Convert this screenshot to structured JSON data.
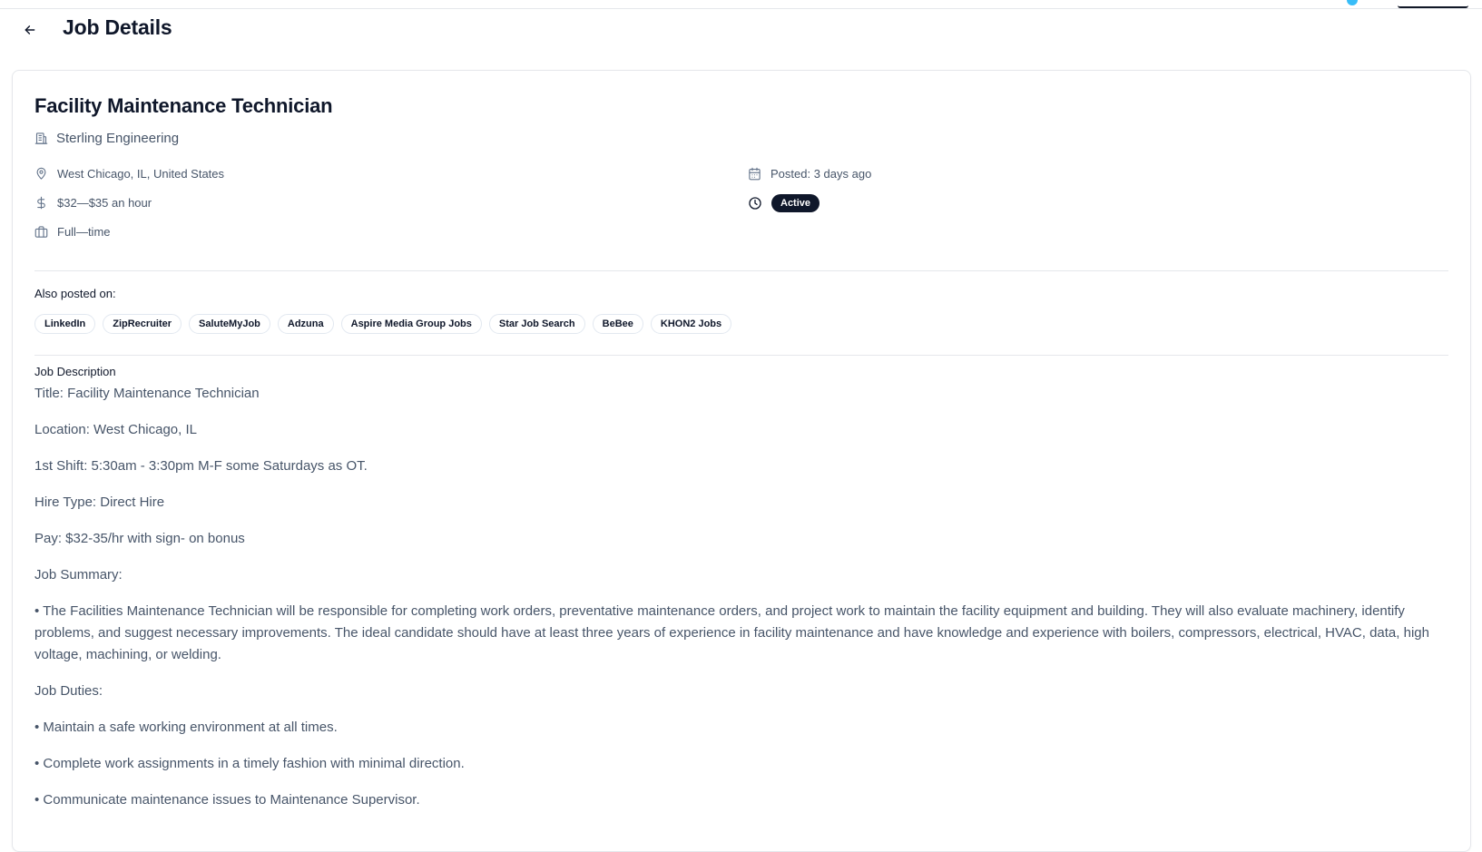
{
  "header": {
    "title": "Job Details"
  },
  "job": {
    "title": "Facility Maintenance Technician",
    "company": "Sterling Engineering",
    "location": "West Chicago, IL, United States",
    "pay": "$32—$35 an hour",
    "type": "Full—time",
    "posted": "Posted: 3 days ago",
    "status": "Active"
  },
  "also_posted": {
    "label": "Also posted on:",
    "sites": [
      "LinkedIn",
      "ZipRecruiter",
      "SaluteMyJob",
      "Adzuna",
      "Aspire Media Group Jobs",
      "Star Job Search",
      "BeBee",
      "KHON2 Jobs"
    ]
  },
  "description": {
    "label": "Job Description",
    "paragraphs": [
      "Title: Facility Maintenance Technician",
      "Location: West Chicago, IL",
      "1st Shift: 5:30am - 3:30pm M-F some Saturdays as OT.",
      "Hire Type: Direct Hire",
      "Pay: $32-35/hr with sign- on bonus",
      "Job Summary:",
      "• The Facilities Maintenance Technician will be responsible for completing work orders, preventative maintenance orders, and project work to maintain the facility equipment and building. They will also evaluate machinery, identify problems, and suggest necessary improvements. The ideal candidate should have at least three years of experience in facility maintenance and have knowledge and experience with boilers, compressors, electrical, HVAC, data, high voltage, machining, or welding.",
      "Job Duties:",
      "• Maintain a safe working environment at all times.",
      "• Complete work assignments in a timely fashion with minimal direction.",
      "• Communicate maintenance issues to Maintenance Supervisor."
    ]
  },
  "icons": {
    "back": "arrow-left-icon",
    "company": "building-icon",
    "location": "map-pin-icon",
    "pay": "dollar-icon",
    "type": "briefcase-icon",
    "posted": "calendar-icon",
    "status": "clock-icon"
  },
  "colors": {
    "text_primary": "#0f172a",
    "text_secondary": "#475569",
    "badge_bg": "#0f172a",
    "border": "#e5e7eb"
  }
}
